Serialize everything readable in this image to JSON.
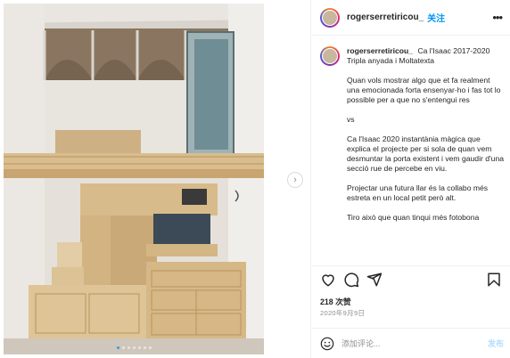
{
  "header": {
    "username": "rogerserretiricou_",
    "follow_label": "关注",
    "more_label": "•••"
  },
  "caption": {
    "username": "rogerserretiricou_",
    "title_line": "Ca l'Isaac 2017-2020 Tripla anyada i Moltatexta",
    "paragraphs": [
      "Quan vols mostrar algo que et fa realment una emocionada forta ensenyar-ho i fas tot lo possible per a que no s'entengui res",
      "vs",
      "Ca l'Isaac 2020 instantània màgica que explica el projecte per si sola de quan vem desmuntar la porta existent i vem gaudir d'una secció rue de percebe en viu.",
      "Projectar una futura llar és la collabo més estreta en un local petit però alt.",
      "Tiro això que quan tinqui més fotobona"
    ]
  },
  "stats": {
    "likes": "218 次赞",
    "date": "2020年9月9日"
  },
  "comment": {
    "placeholder": "添加评论...",
    "post_label": "发布"
  },
  "carousel": {
    "next_label": "›",
    "dot_count": 7,
    "active_index": 0
  },
  "icons": {
    "like": "heart-icon",
    "comment": "comment-icon",
    "share": "paper-plane-icon",
    "save": "bookmark-icon",
    "emoji": "smiley-icon"
  },
  "colors": {
    "accent": "#0095f6",
    "post_disabled": "#b2dffc",
    "text": "#262626",
    "muted": "#8e8e8e"
  }
}
